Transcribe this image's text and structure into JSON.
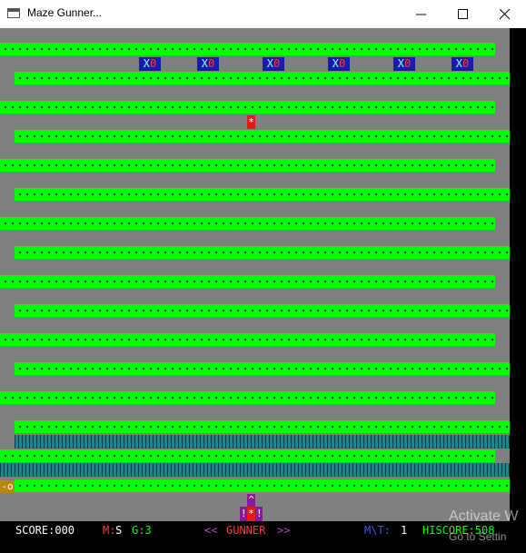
{
  "window": {
    "title": "Maze Gunner..."
  },
  "enemies": [
    {
      "x_glyph": "X",
      "o_glyph": "0"
    },
    {
      "x_glyph": "X",
      "o_glyph": "0"
    },
    {
      "x_glyph": "X",
      "o_glyph": "0"
    },
    {
      "x_glyph": "X",
      "o_glyph": "0"
    },
    {
      "x_glyph": "X",
      "o_glyph": "0"
    },
    {
      "x_glyph": "X",
      "o_glyph": "0"
    }
  ],
  "bullet": {
    "glyph": "*"
  },
  "marker": {
    "glyph": "-o"
  },
  "ship": {
    "top": "^",
    "left": "!",
    "center": "*",
    "right": "!"
  },
  "status": {
    "score": "SCORE:000",
    "m_label": "M:",
    "m_value": "S",
    "g_label": "G:3",
    "left_arrows": "<<",
    "name": "GUNNER",
    "right_arrows": ">>",
    "mt_label": "M\\T:",
    "mt_value": "1",
    "hiscore": "HISCORE:508"
  },
  "watermark": {
    "line1": "Activate W",
    "line2": "Go to Settin"
  },
  "colors": {
    "wall": "#00ff00",
    "floor": "#808080",
    "enemy": "#1a1aa8",
    "bullet": "#e31a1a",
    "ship": "#8a1a9a",
    "teal_row": "#0b8b8b"
  }
}
